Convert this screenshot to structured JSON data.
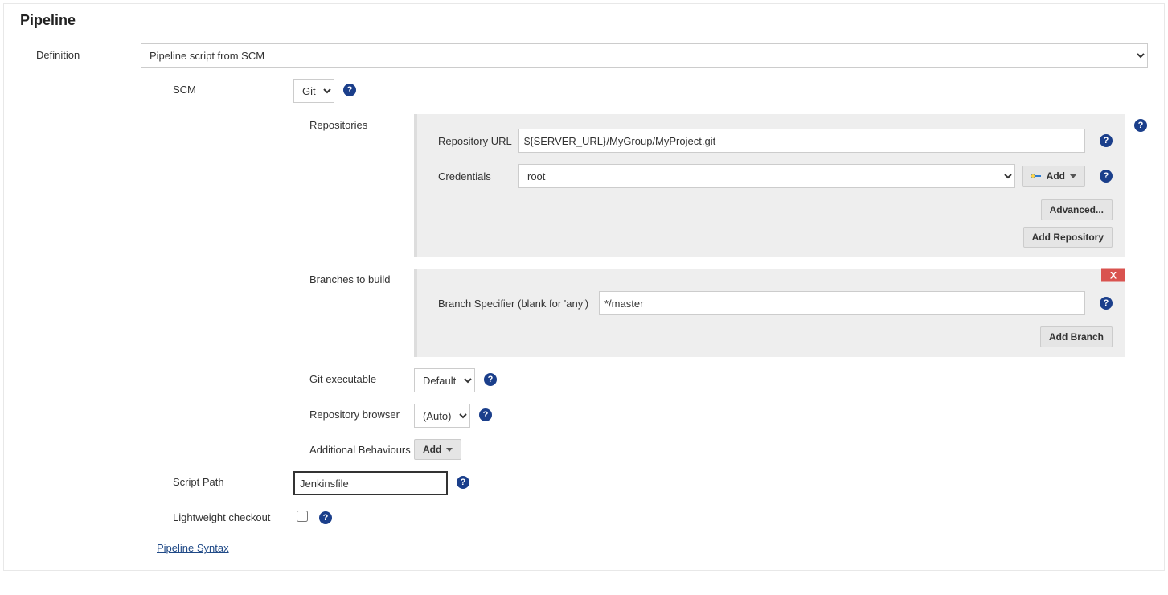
{
  "section_title": "Pipeline",
  "definition": {
    "label": "Definition",
    "value": "Pipeline script from SCM"
  },
  "scm": {
    "label": "SCM",
    "value": "Git"
  },
  "repositories": {
    "label": "Repositories",
    "repo_url_label": "Repository URL",
    "repo_url_value": "${SERVER_URL}/MyGroup/MyProject.git",
    "credentials_label": "Credentials",
    "credentials_value": "root",
    "add_cred_label": "Add",
    "advanced_label": "Advanced...",
    "add_repo_label": "Add Repository"
  },
  "branches": {
    "label": "Branches to build",
    "specifier_label": "Branch Specifier (blank for 'any')",
    "specifier_value": "*/master",
    "add_branch_label": "Add Branch",
    "delete_label": "X"
  },
  "git_exec": {
    "label": "Git executable",
    "value": "Default"
  },
  "repo_browser": {
    "label": "Repository browser",
    "value": "(Auto)"
  },
  "additional_behaviours": {
    "label": "Additional Behaviours",
    "add_label": "Add"
  },
  "script_path": {
    "label": "Script Path",
    "value": "Jenkinsfile"
  },
  "lightweight": {
    "label": "Lightweight checkout",
    "checked": false
  },
  "syntax_link": "Pipeline Syntax"
}
